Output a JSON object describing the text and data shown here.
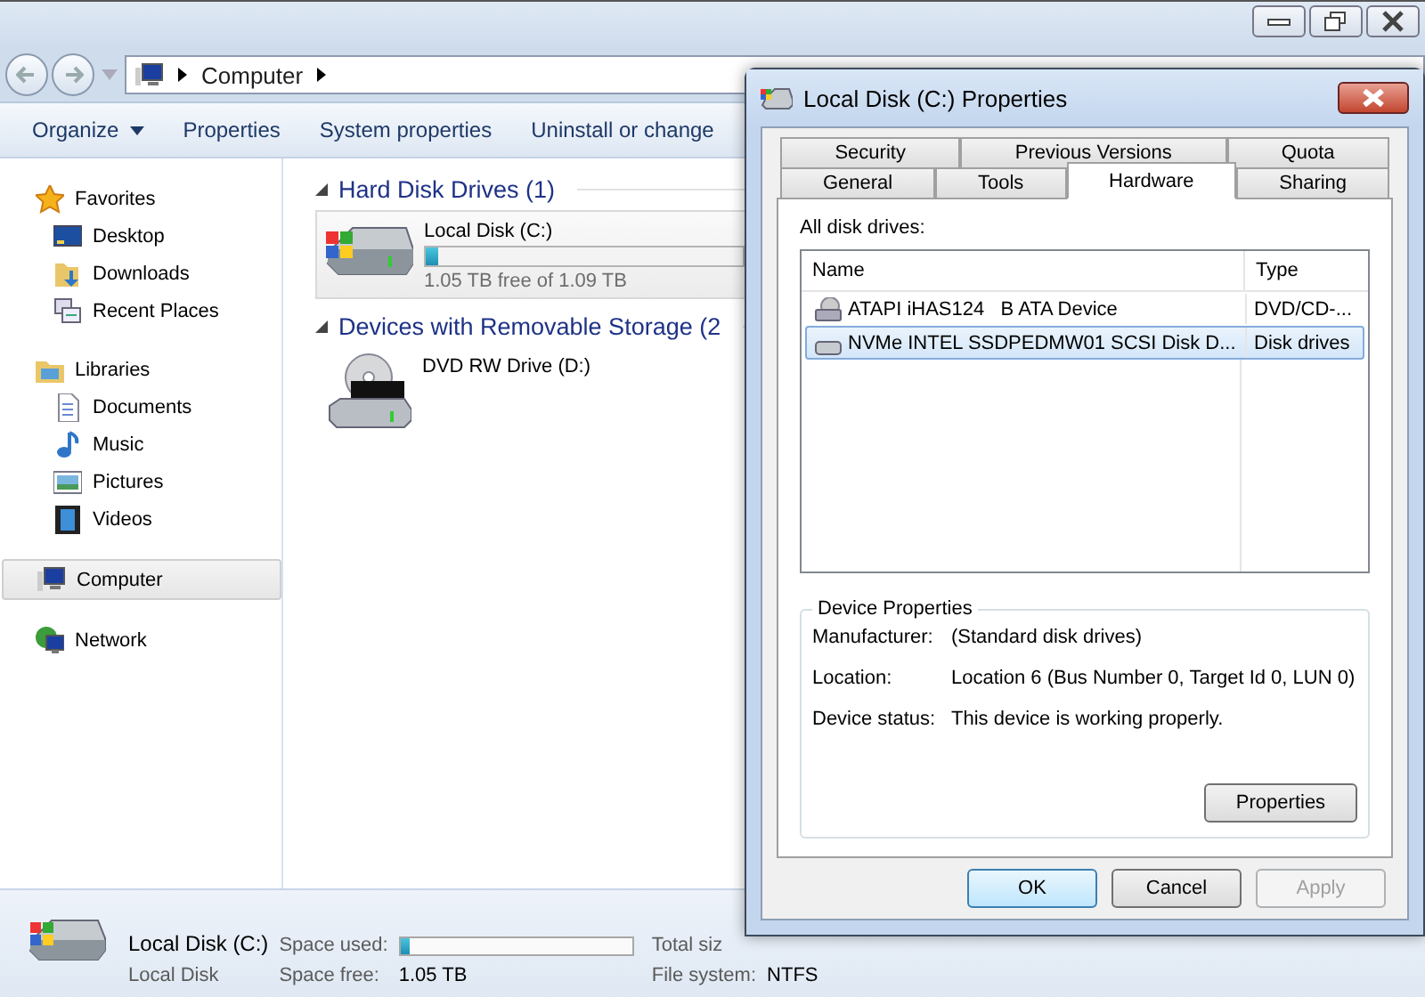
{
  "explorer": {
    "address": [
      "Computer"
    ],
    "toolbar": [
      {
        "label": "Organize",
        "dropdown": true
      },
      {
        "label": "Properties",
        "dropdown": false
      },
      {
        "label": "System properties",
        "dropdown": false
      },
      {
        "label": "Uninstall or change",
        "dropdown": false
      }
    ],
    "nav": [
      {
        "label": "Favorites",
        "kind": "star",
        "selected": false,
        "children": [
          {
            "label": "Desktop",
            "kind": "desktop",
            "selected": false
          },
          {
            "label": "Downloads",
            "kind": "downloads",
            "selected": false
          },
          {
            "label": "Recent Places",
            "kind": "recent",
            "selected": false
          }
        ]
      },
      {
        "label": "Libraries",
        "kind": "library",
        "selected": false,
        "children": [
          {
            "label": "Documents",
            "kind": "document",
            "selected": false
          },
          {
            "label": "Music",
            "kind": "music",
            "selected": false
          },
          {
            "label": "Pictures",
            "kind": "pictures",
            "selected": false
          },
          {
            "label": "Videos",
            "kind": "videos",
            "selected": false
          }
        ]
      },
      {
        "label": "Computer",
        "kind": "computer",
        "selected": true
      },
      {
        "label": "Network",
        "kind": "network",
        "selected": false
      }
    ],
    "groups": [
      {
        "title": "Hard Disk Drives (1)",
        "items": [
          {
            "kind": "disk",
            "name": "Local Disk (C:)",
            "level": 0.04,
            "free": "1.05 TB free of 1.09 TB"
          }
        ]
      },
      {
        "title": "Devices with Removable Storage (2",
        "items": [
          {
            "kind": "dvd",
            "name": "DVD RW Drive (D:)"
          }
        ]
      }
    ],
    "status": {
      "name": "Local Disk (C:)",
      "type": "Local Disk",
      "used_label": "Space used:",
      "level": 0.04,
      "free_label": "Space free:",
      "free": "1.05 TB",
      "total_label": "Total siz",
      "fs_label": "File system:",
      "fs": "NTFS"
    }
  },
  "dialog": {
    "title": "Local Disk (C:) Properties",
    "tab_rows": [
      [
        {
          "label": "Security",
          "selected": false
        },
        {
          "label": "Previous Versions",
          "selected": false
        },
        {
          "label": "Quota",
          "selected": false
        }
      ],
      [
        {
          "label": "General",
          "selected": false
        },
        {
          "label": "Tools",
          "selected": false
        },
        {
          "label": "Hardware",
          "selected": true
        },
        {
          "label": "Sharing",
          "selected": false
        }
      ]
    ],
    "list_label": "All disk drives:",
    "columns": [
      "Name",
      "Type"
    ],
    "rows": [
      {
        "kind": "dvd",
        "name": "ATAPI iHAS124   B ATA Device",
        "type": "DVD/CD-...",
        "selected": false
      },
      {
        "kind": "disk",
        "name": "NVMe INTEL SSDPEDMW01 SCSI Disk D...",
        "type": "Disk drives",
        "selected": true
      }
    ],
    "group_title": "Device Properties",
    "props": [
      {
        "label": "Manufacturer:",
        "value": "(Standard disk drives)"
      },
      {
        "label": "Location:",
        "value": "Location 6 (Bus Number 0, Target Id 0, LUN 0)"
      },
      {
        "label": "Device status:",
        "value": "This device is working properly."
      }
    ],
    "properties_button": "Properties",
    "buttons": [
      {
        "label": "OK",
        "default": true,
        "disabled": false
      },
      {
        "label": "Cancel",
        "default": false,
        "disabled": false
      },
      {
        "label": "Apply",
        "default": false,
        "disabled": true
      }
    ]
  }
}
